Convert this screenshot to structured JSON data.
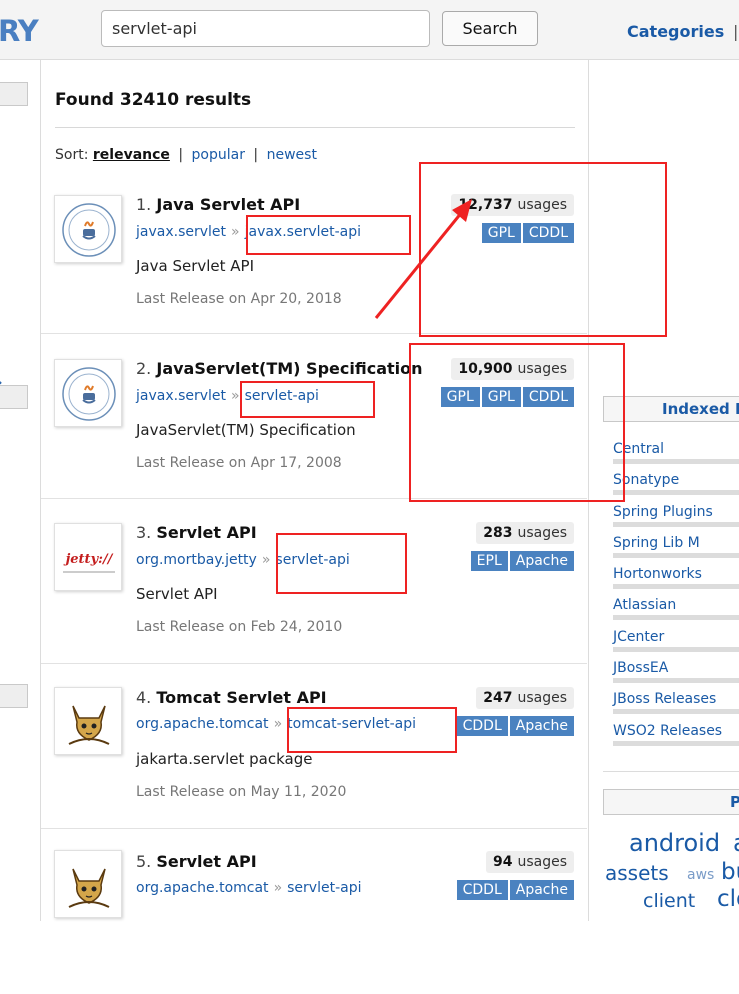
{
  "header": {
    "logo_fragment": "RY",
    "search_value": "servlet-api",
    "search_button": "Search",
    "nav_categories": "Categories",
    "nav_separator": "|"
  },
  "main": {
    "results_count": "Found 32410 results",
    "sort": {
      "label": "Sort:",
      "current": "relevance",
      "separator": "|",
      "options": [
        "popular",
        "newest"
      ]
    },
    "results": [
      {
        "index": "1.",
        "title": "Java Servlet API",
        "group": "javax.servlet",
        "arrow": "»",
        "artifact": "javax.servlet-api",
        "description": "Java Servlet API",
        "release": "Last Release on Apr 20, 2018",
        "usages_count": "12,737",
        "usages_label": "usages",
        "licenses": [
          "GPL",
          "CDDL"
        ],
        "icon": "jcp-logo-icon"
      },
      {
        "index": "2.",
        "title": "JavaServlet(TM) Specification",
        "group": "javax.servlet",
        "arrow": "»",
        "artifact": "servlet-api",
        "description": "JavaServlet(TM) Specification",
        "release": "Last Release on Apr 17, 2008",
        "usages_count": "10,900",
        "usages_label": "usages",
        "licenses": [
          "GPL",
          "GPL",
          "CDDL"
        ],
        "icon": "jcp-logo-icon"
      },
      {
        "index": "3.",
        "title": "Servlet API",
        "group": "org.mortbay.jetty",
        "arrow": "»",
        "artifact": "servlet-api",
        "description": "Servlet API",
        "release": "Last Release on Feb 24, 2010",
        "usages_count": "283",
        "usages_label": "usages",
        "licenses": [
          "EPL",
          "Apache"
        ],
        "icon": "jetty-logo-icon",
        "icon_text": "jetty://"
      },
      {
        "index": "4.",
        "title": "Tomcat Servlet API",
        "group": "org.apache.tomcat",
        "arrow": "»",
        "artifact": "tomcat-servlet-api",
        "description": "jakarta.servlet package",
        "release": "Last Release on May 11, 2020",
        "usages_count": "247",
        "usages_label": "usages",
        "licenses": [
          "CDDL",
          "Apache"
        ],
        "icon": "tomcat-logo-icon"
      },
      {
        "index": "5.",
        "title": "Servlet API",
        "group": "org.apache.tomcat",
        "arrow": "»",
        "artifact": "servlet-api",
        "description": "",
        "release": "",
        "usages_count": "94",
        "usages_label": "usages",
        "licenses": [
          "CDDL",
          "Apache"
        ],
        "icon": "tomcat-logo-icon"
      }
    ]
  },
  "right": {
    "indexed_heading": "Indexed R",
    "repositories": [
      "Central",
      "Sonatype",
      "Spring Plugins",
      "Spring Lib M",
      "Hortonworks",
      "Atlassian",
      "JCenter",
      "JBossEA",
      "JBoss Releases",
      "WSO2 Releases"
    ],
    "second_heading": "P",
    "tags": [
      "android",
      "ap",
      "assets",
      "aws",
      "bui",
      "client",
      "cloj"
    ]
  },
  "colors": {
    "link": "#1a5aa6",
    "license_badge": "#4a82c0",
    "annotation": "#ee2222"
  }
}
